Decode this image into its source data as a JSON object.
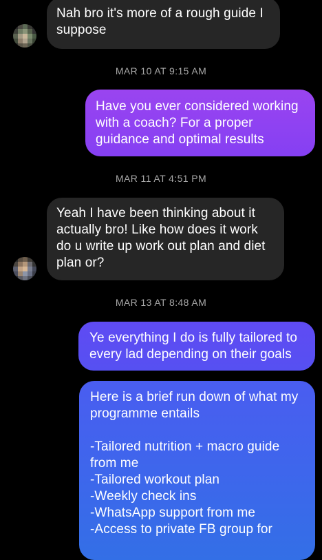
{
  "messages": [
    {
      "sender": "them",
      "text": "Nah bro it's more of a rough guide I suppose"
    },
    {
      "sender": "me",
      "text": "Have you ever considered working with a coach? For a proper guidance and optimal results"
    },
    {
      "sender": "them",
      "text": "Yeah I have been thinking about it actually bro! Like how does it work do u write up work out plan and diet plan or?"
    },
    {
      "sender": "me",
      "text": "Ye everything I do is fully tailored to every lad depending on their goals"
    },
    {
      "sender": "me",
      "text": "Here is a brief run down of what my programme entails\n\n-Tailored nutrition + macro guide from me\n-Tailored workout plan\n-Weekly check ins\n-WhatsApp support from me\n-Access to private FB group for"
    }
  ],
  "timestamps": [
    "MAR 10 AT 9:15 AM",
    "MAR 11 AT 4:51 PM",
    "MAR 13 AT 8:48 AM"
  ],
  "colors": {
    "background": "#000000",
    "incoming_bubble": "#262626",
    "outgoing_purple": "#8a3ff0",
    "outgoing_indigo": "#5b4cf2",
    "outgoing_blue": "#3569e8",
    "timestamp": "#a8a8a8"
  },
  "avatars": [
    {
      "name": "contact-avatar-pixelated"
    },
    {
      "name": "contact-avatar-pixelated"
    }
  ]
}
